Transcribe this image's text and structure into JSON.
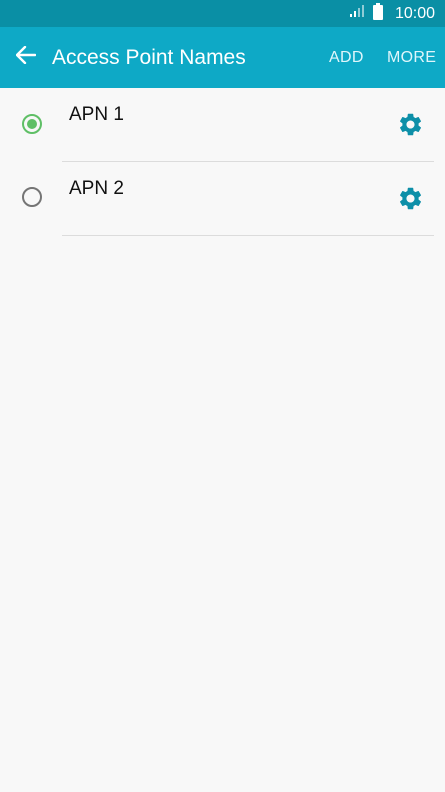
{
  "status_bar": {
    "time": "10:00",
    "icons": [
      "signal-icon",
      "battery-icon"
    ]
  },
  "app_bar": {
    "back_icon": "arrow-back-icon",
    "title": "Access Point Names",
    "actions": {
      "add": "ADD",
      "more": "MORE"
    }
  },
  "apns": [
    {
      "label": "APN 1",
      "selected": true,
      "settings_icon": "gear-icon"
    },
    {
      "label": "APN 2",
      "selected": false,
      "settings_icon": "gear-icon"
    }
  ],
  "colors": {
    "status_bar": "#0a8fa5",
    "app_bar": "#0ea9c6",
    "radio_selected": "#5fbf66",
    "gear": "#0d8fa8",
    "background": "#f8f8f8"
  }
}
